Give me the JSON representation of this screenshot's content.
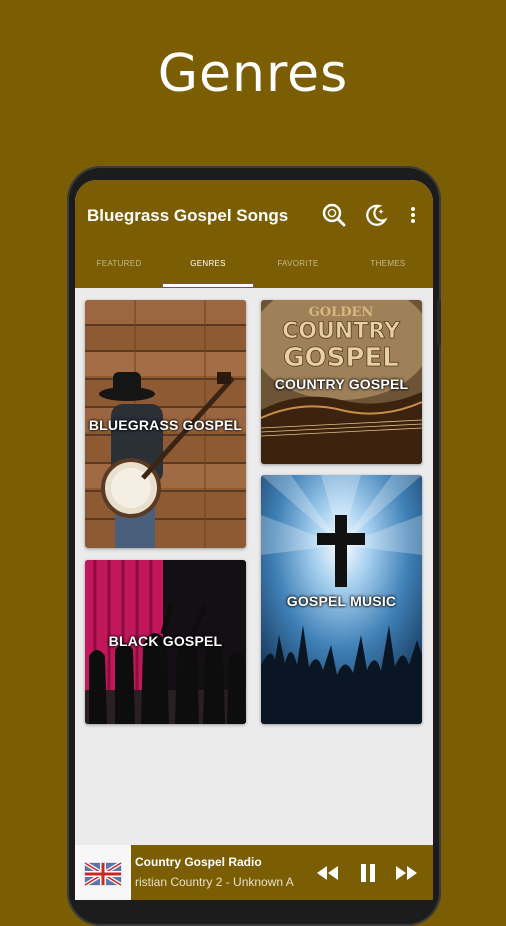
{
  "page": {
    "heading": "Genres"
  },
  "colors": {
    "brand": "#7b5e03",
    "screen_bg": "#ebebeb",
    "text": "#ffffff"
  },
  "app": {
    "title": "Bluegrass Gospel Songs",
    "icons": [
      "search-icon",
      "night-mode-icon",
      "more-vert-icon"
    ]
  },
  "tabs": [
    {
      "label": "FEATURED",
      "active": false
    },
    {
      "label": "GENRES",
      "active": true
    },
    {
      "label": "FAVORITE",
      "active": false
    },
    {
      "label": "THEMES",
      "active": false
    }
  ],
  "genres": [
    {
      "label": "BLUEGRASS GOSPEL"
    },
    {
      "label": "COUNTRY GOSPEL",
      "art_title_top": "GOLDEN",
      "art_title_main_1": "COUNTRY",
      "art_title_main_2": "GOSPEL"
    },
    {
      "label": "GOSPEL MUSIC"
    },
    {
      "label": "BLACK GOSPEL"
    }
  ],
  "player": {
    "title": "Country Gospel Radio",
    "subtitle": "ristian Country 2 - Unknown A",
    "controls": [
      "rewind-icon",
      "pause-icon",
      "fast-forward-icon"
    ]
  }
}
